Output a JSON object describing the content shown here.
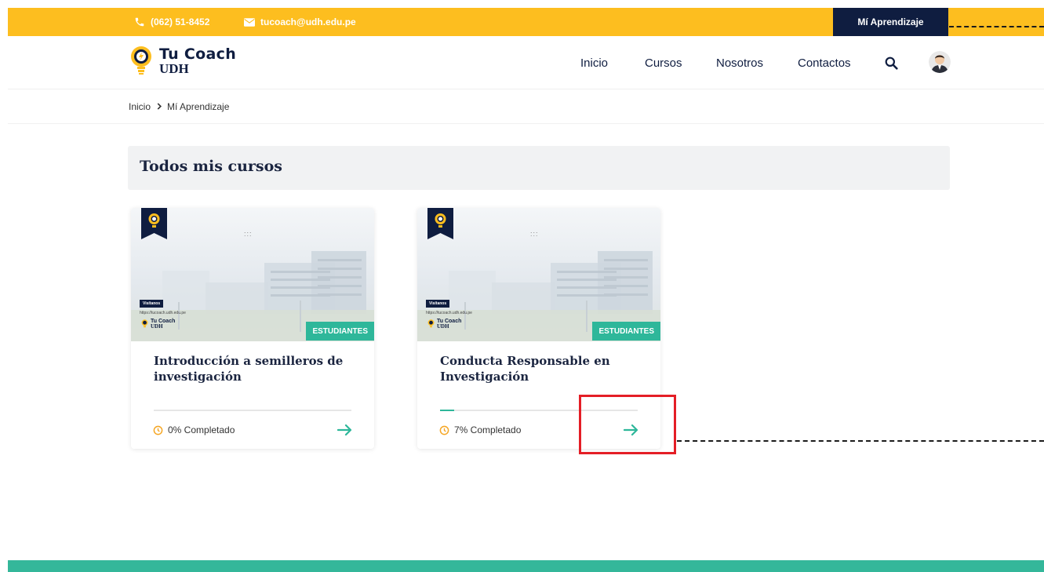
{
  "topbar": {
    "phone": "(062) 51-8452",
    "email": "tucoach@udh.edu.pe",
    "learning_button": "Mí Aprendizaje"
  },
  "logo": {
    "line1": "Tu Coach",
    "line2": "UDH"
  },
  "nav": {
    "items": [
      "Inicio",
      "Cursos",
      "Nosotros",
      "Contactos"
    ]
  },
  "breadcrumb": {
    "home": "Inicio",
    "current": "Mí Aprendizaje"
  },
  "section": {
    "title": "Todos mis cursos"
  },
  "courses": [
    {
      "title": "Introducción a semilleros de investigación",
      "tag": "ESTUDIANTES",
      "progress": 0,
      "status": "0% Completado",
      "thumb": {
        "badge": "Visítanos",
        "url": "https://tucoach.udh.edu.pe",
        "dots": ":::",
        "logo_a": "Tu Coach",
        "logo_b": "UDH"
      }
    },
    {
      "title": "Conducta Responsable en Investigación",
      "tag": "ESTUDIANTES",
      "progress": 7,
      "status": "7% Completado",
      "thumb": {
        "badge": "Visítanos",
        "url": "https://tucoach.udh.edu.pe",
        "dots": ":::",
        "logo_a": "Tu Coach",
        "logo_b": "UDH"
      }
    }
  ],
  "colors": {
    "topbar": "#FDBE1F",
    "navy": "#0F1D40",
    "accent": "#2EB79A",
    "annotation": "#E41E26"
  },
  "icons": {
    "phone": "phone-icon",
    "email": "envelope-icon",
    "search": "search-icon",
    "avatar": "user-avatar",
    "progress": "clock-icon",
    "arrow": "arrow-right-icon"
  }
}
